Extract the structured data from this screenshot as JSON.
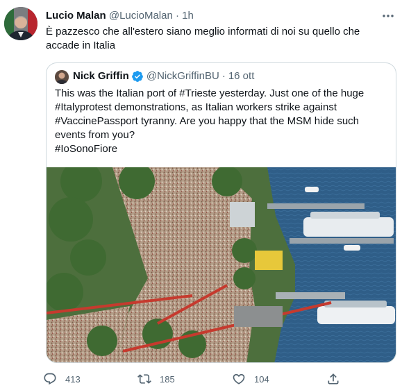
{
  "tweet": {
    "author_name": "Lucio Malan",
    "author_handle": "@LucioMalan",
    "separator": "·",
    "time": "1h",
    "text": "È pazzesco che all'estero siano meglio informati di noi su quello che accade in Italia"
  },
  "quoted": {
    "author_name": "Nick Griffin",
    "author_handle": "@NickGriffinBU",
    "separator": "·",
    "date": "16 ott",
    "lines": [
      "This was the Italian port of #Trieste yesterday. Just one of the huge",
      "#Italyprotest demonstrations, as Italian workers strike against",
      "#VaccinePassport tyranny. Are you happy that the MSM hide such",
      "events from you?",
      "#IoSonoFiore"
    ]
  },
  "actions": {
    "reply_count": "413",
    "retweet_count": "185",
    "like_count": "104"
  },
  "icons": {
    "more": "more-icon",
    "verified": "verified-badge-icon",
    "reply": "reply-icon",
    "retweet": "retweet-icon",
    "like": "heart-icon",
    "share": "share-icon"
  },
  "colors": {
    "text": "#0f1419",
    "muted": "#536471",
    "border": "#cfd9de",
    "verified_blue": "#1d9bf0"
  }
}
